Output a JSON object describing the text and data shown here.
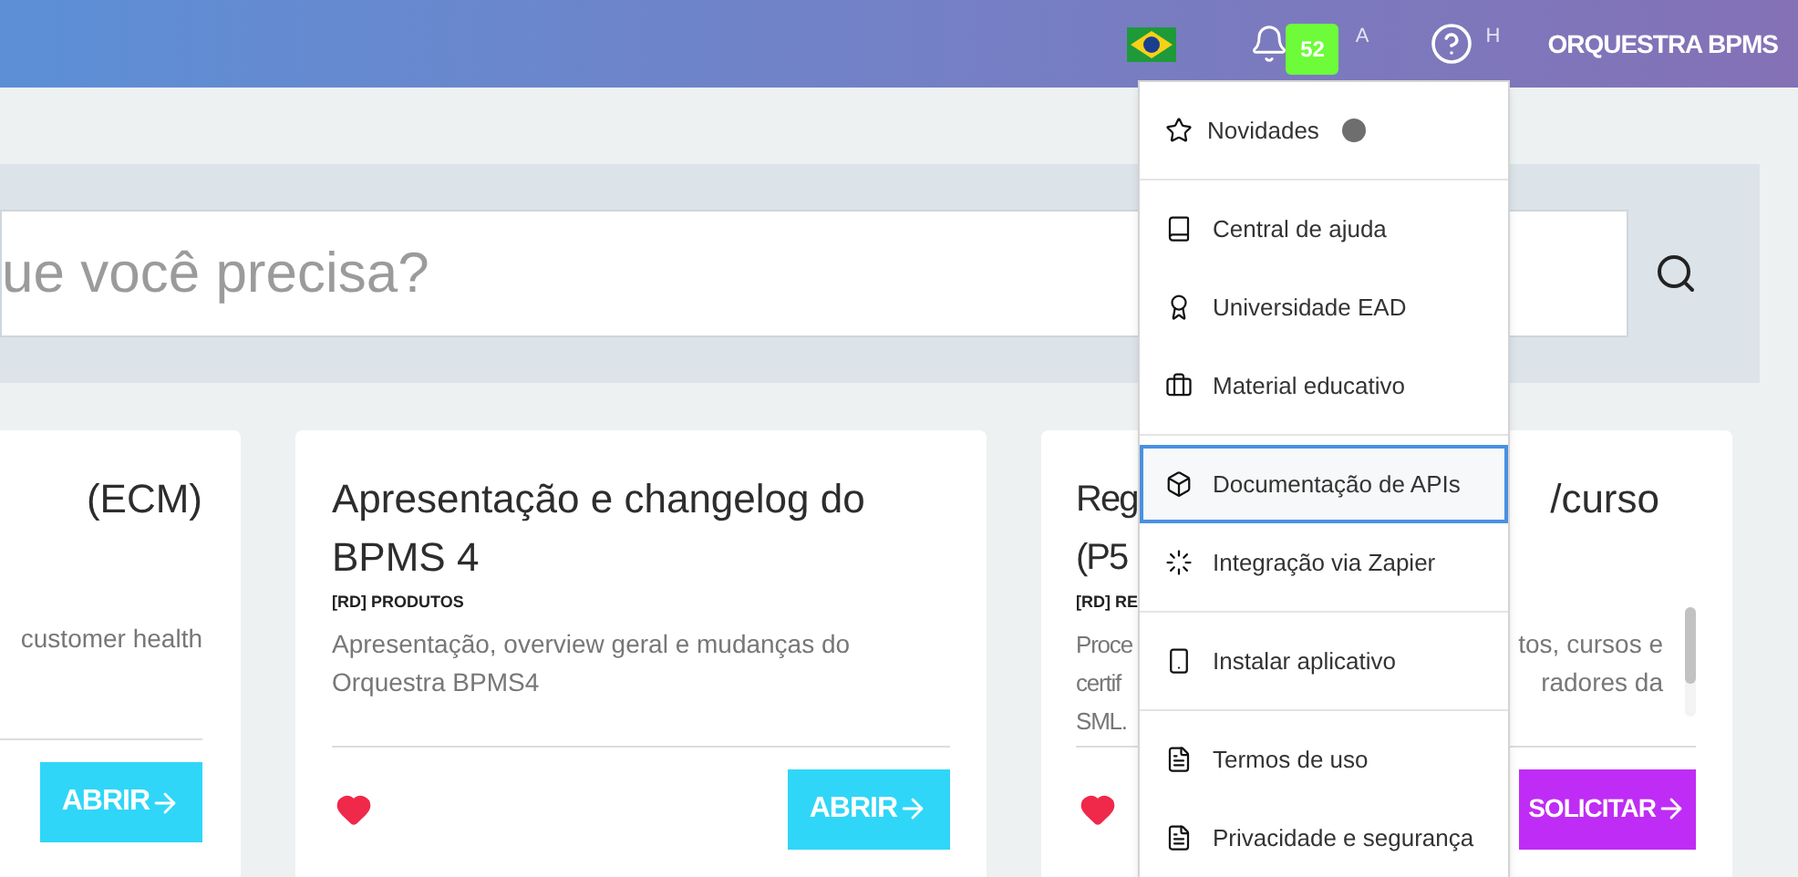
{
  "header": {
    "notifications": {
      "count": "52",
      "suffix": "A"
    },
    "help": {
      "suffix": "H"
    },
    "brand": "ORQUESTRA BPMS"
  },
  "search": {
    "placeholder": "ue você precisa?"
  },
  "cards": [
    {
      "kind": "cut",
      "title_lines": [
        "(ECM)"
      ],
      "description_lines": [
        "customer health"
      ],
      "button": {
        "label": "ABRIR",
        "kind": "open"
      }
    },
    {
      "kind": "full",
      "title": "Apresentação e changelog do BPMS 4",
      "tag": "[RD] PRODUTOS",
      "description": "Apresentação, overview geral e mudanças do Orquestra BPMS4",
      "favorite": true,
      "button": {
        "label": "ABRIR",
        "kind": "open"
      }
    },
    {
      "kind": "split",
      "title_lines": [
        {
          "left": "Reg",
          "right": "/curso"
        },
        {
          "left": "(P5"
        }
      ],
      "tag": "[RD] RE",
      "description_lines": [
        {
          "left": "Proce",
          "right": "tos, cursos e"
        },
        {
          "left": "certif",
          "right": "radores da"
        },
        {
          "left": "SML."
        }
      ],
      "favorite": true,
      "button": {
        "label": "SOLICITAR",
        "kind": "request"
      }
    }
  ],
  "menu": {
    "sections": [
      [
        {
          "label": "Novidades",
          "kind": "star",
          "dot": true,
          "selected": false
        }
      ],
      [
        {
          "label": "Central de ajuda",
          "kind": "book",
          "selected": false
        },
        {
          "label": "Universidade EAD",
          "kind": "award",
          "selected": false
        },
        {
          "label": "Material educativo",
          "kind": "briefcase",
          "selected": false
        }
      ],
      [
        {
          "label": "Documentação de APIs",
          "kind": "box",
          "selected": true
        },
        {
          "label": "Integração via Zapier",
          "kind": "loader",
          "selected": false
        }
      ],
      [
        {
          "label": "Instalar aplicativo",
          "kind": "phone",
          "selected": false
        }
      ],
      [
        {
          "label": "Termos de uso",
          "kind": "file",
          "selected": false
        },
        {
          "label": "Privacidade e segurança",
          "kind": "file",
          "selected": false
        }
      ]
    ]
  }
}
